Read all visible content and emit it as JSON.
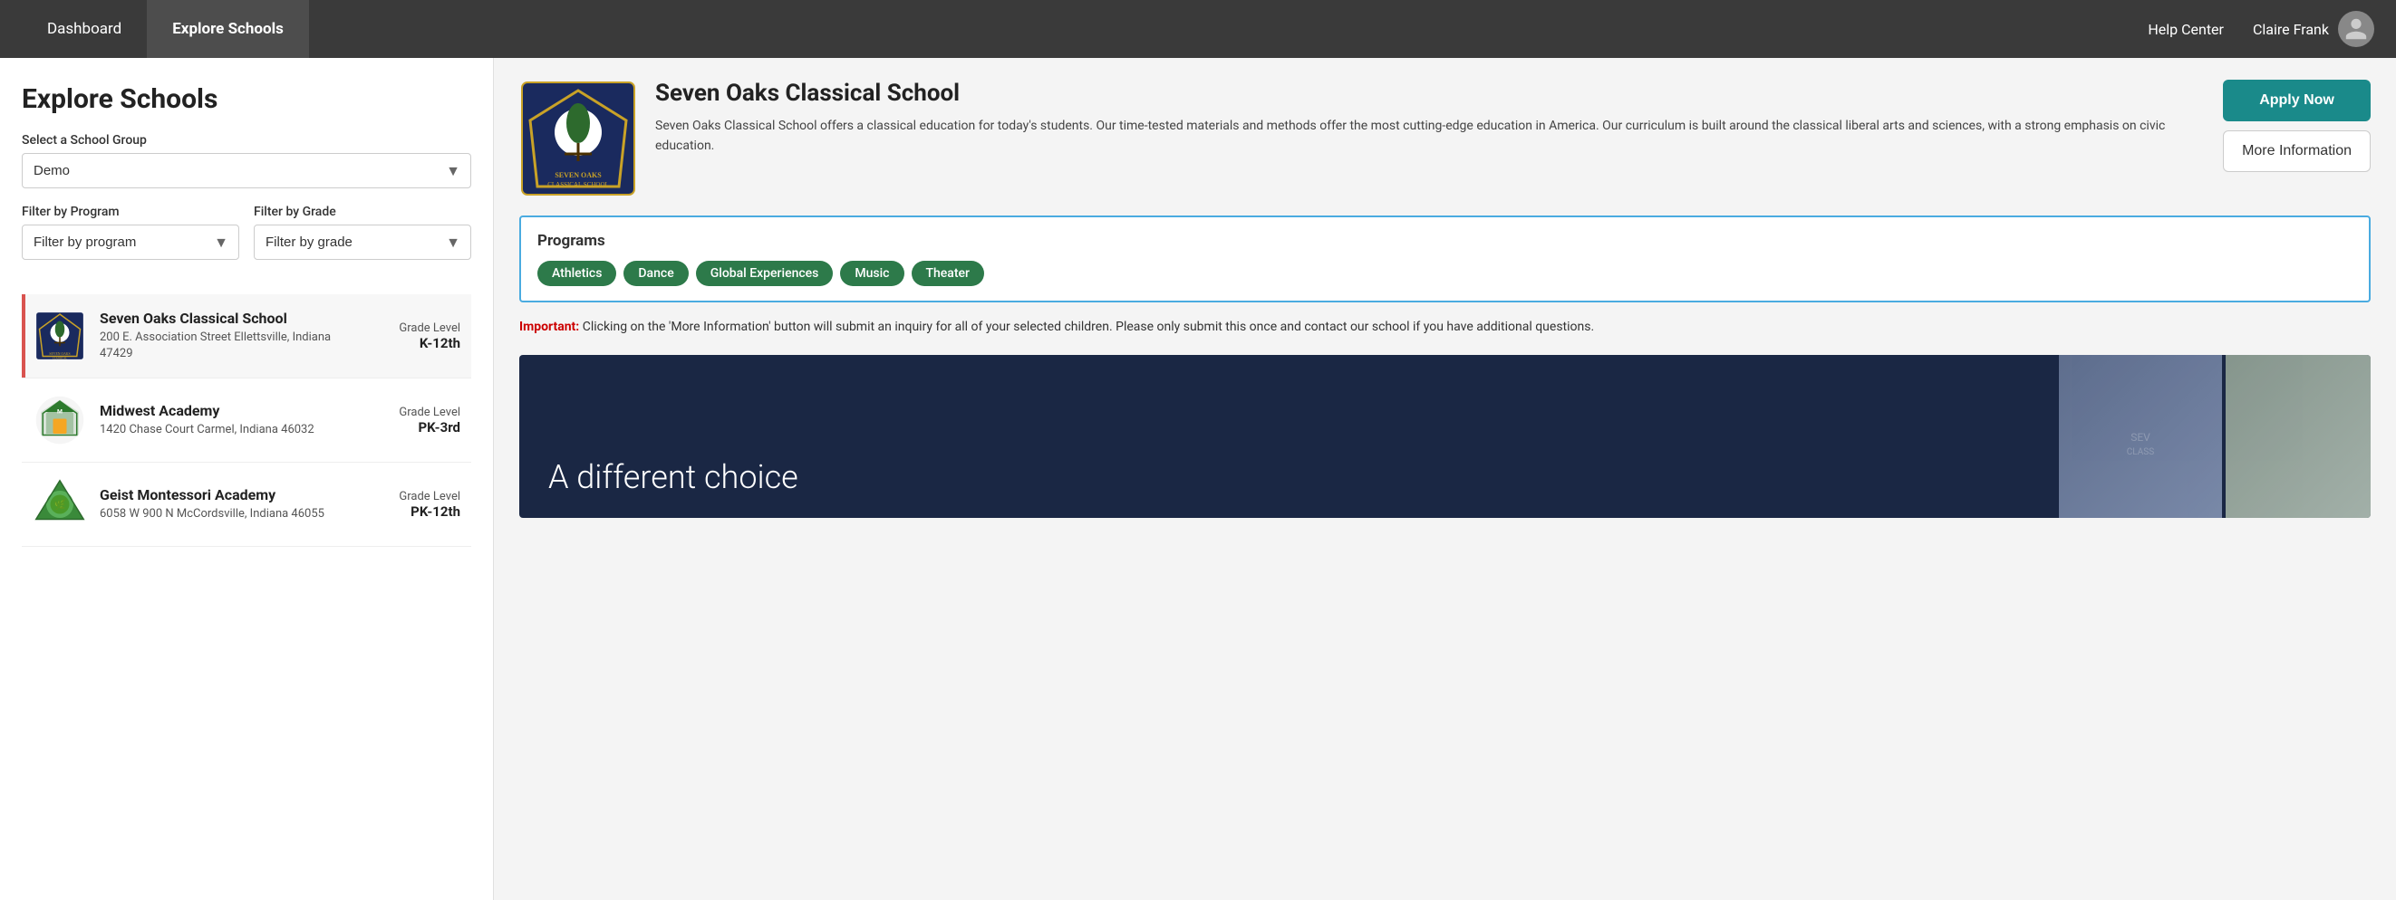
{
  "nav": {
    "items": [
      {
        "label": "Dashboard",
        "active": false
      },
      {
        "label": "Explore Schools",
        "active": true
      }
    ],
    "help_label": "Help Center",
    "user_name": "Claire Frank"
  },
  "page": {
    "title": "Explore Schools"
  },
  "left_panel": {
    "select_group_label": "Select a School Group",
    "select_group_value": "Demo",
    "filter_program_label": "Filter by Program",
    "filter_program_placeholder": "Filter by program",
    "filter_grade_label": "Filter by Grade",
    "filter_grade_placeholder": "Filter by grade"
  },
  "schools": [
    {
      "name": "Seven Oaks Classical School",
      "address": "200 E. Association Street Ellettsville, Indiana 47429",
      "grade_label": "Grade Level",
      "grade_value": "K-12th",
      "selected": true
    },
    {
      "name": "Midwest Academy",
      "address": "1420 Chase Court Carmel, Indiana 46032",
      "grade_label": "Grade Level",
      "grade_value": "PK-3rd",
      "selected": false
    },
    {
      "name": "Geist Montessori Academy",
      "address": "6058 W 900 N McCordsville, Indiana 46055",
      "grade_label": "Grade Level",
      "grade_value": "PK-12th",
      "selected": false
    }
  ],
  "detail": {
    "school_name": "Seven Oaks Classical School",
    "description": "Seven Oaks Classical School offers a classical education for today's students. Our time-tested materials and methods offer the most cutting-edge education in America. Our curriculum is built around the classical liberal arts and sciences, with a strong emphasis on civic education.",
    "apply_label": "Apply Now",
    "more_info_label": "More Information",
    "programs_title": "Programs",
    "programs": [
      "Athletics",
      "Dance",
      "Global Experiences",
      "Music",
      "Theater"
    ],
    "important_label": "Important:",
    "important_text": " Clicking on the 'More Information' button will submit an inquiry for all of your selected children. Please only submit this once and contact our school if you have additional questions.",
    "banner_text": "A different choice"
  },
  "colors": {
    "nav_bg": "#3a3a3a",
    "active_nav": "#4d4d4d",
    "teal": "#1a8a8a",
    "green_tag": "#2d7a4a",
    "red_stripe": "#d9534f",
    "blue_border": "#4aabe0",
    "dark_navy": "#1a2744"
  }
}
